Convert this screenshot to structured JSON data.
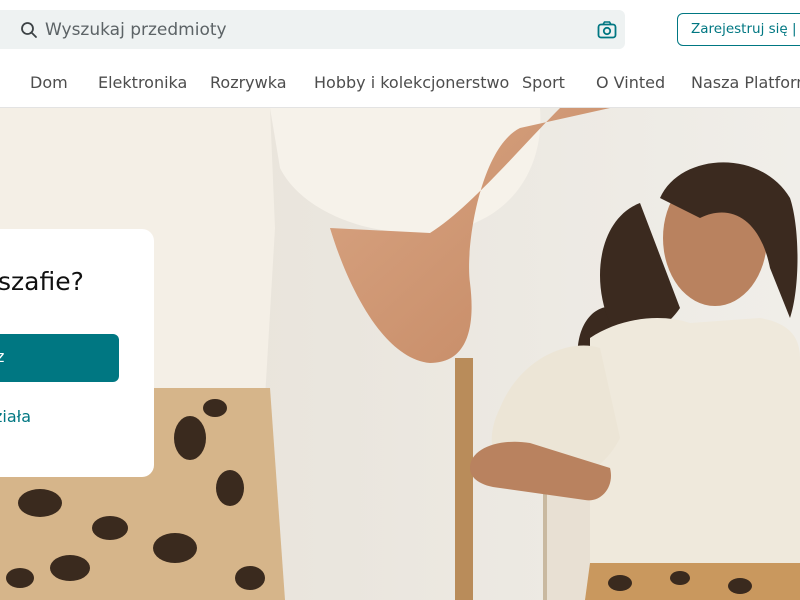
{
  "header": {
    "search_placeholder": "Wyszukaj przedmioty",
    "signup_label": "Zarejestruj się | Za"
  },
  "nav": {
    "items": [
      "Dom",
      "Elektronika",
      "Rozrywka",
      "Hobby i kolekcjonerstwo",
      "Sport",
      "O Vinted",
      "Nasza Platform"
    ]
  },
  "hero": {
    "card_title": "szafie?",
    "cta_label": "z",
    "secondary_link": "ziała"
  },
  "colors": {
    "brand": "#007782",
    "search_bg": "#eef2f2"
  },
  "icons": {
    "search": "search-icon",
    "camera": "camera-icon"
  }
}
